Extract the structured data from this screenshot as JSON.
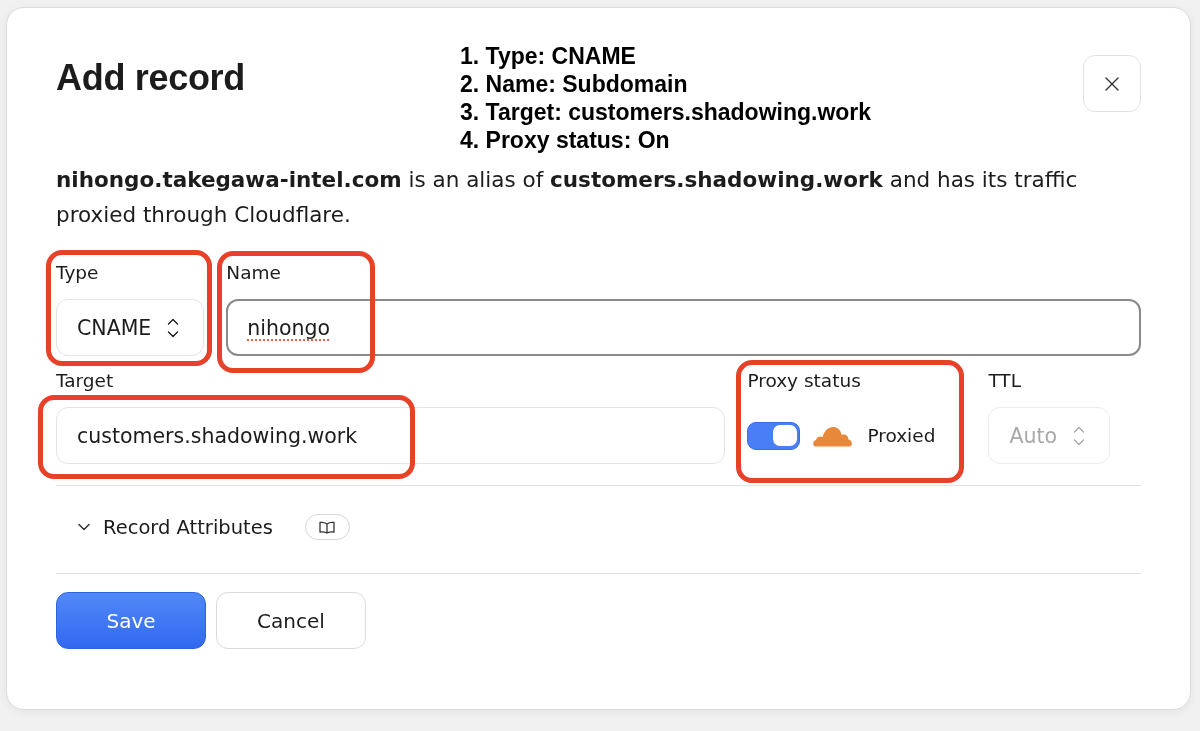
{
  "dialog": {
    "title": "Add record"
  },
  "annotation_notes": [
    "1. Type: CNAME",
    "2. Name: Subdomain",
    "3. Target: customers.shadowing.work",
    "4. Proxy status: On"
  ],
  "description": "**nihongo.takegawa-intel.com** is an alias of **customers.shadowing.work** and has its traffic proxied through Cloudflare.",
  "form_rows": [
    {
      "fields": [
        {
          "kind": "select",
          "label": "Type",
          "value": "CNAME",
          "disabled": false,
          "highlighted": true
        },
        {
          "kind": "text",
          "label": "Name",
          "value": "nihongo",
          "focused": true,
          "misspelled": true,
          "highlighted": true
        }
      ]
    },
    {
      "fields": [
        {
          "kind": "text",
          "label": "Target",
          "value": "customers.shadowing.work",
          "focused": false,
          "misspelled": false,
          "highlighted": true
        },
        {
          "kind": "toggle",
          "label": "Proxy status",
          "on": true,
          "status": "Proxied",
          "highlighted": true
        },
        {
          "kind": "select",
          "label": "TTL",
          "value": "Auto",
          "disabled": true,
          "highlighted": false
        }
      ]
    }
  ],
  "record_attributes": {
    "label": "Record Attributes",
    "expanded": false
  },
  "buttons": [
    {
      "label": "Save",
      "kind": "primary"
    },
    {
      "label": "Cancel",
      "kind": "secondary"
    }
  ]
}
